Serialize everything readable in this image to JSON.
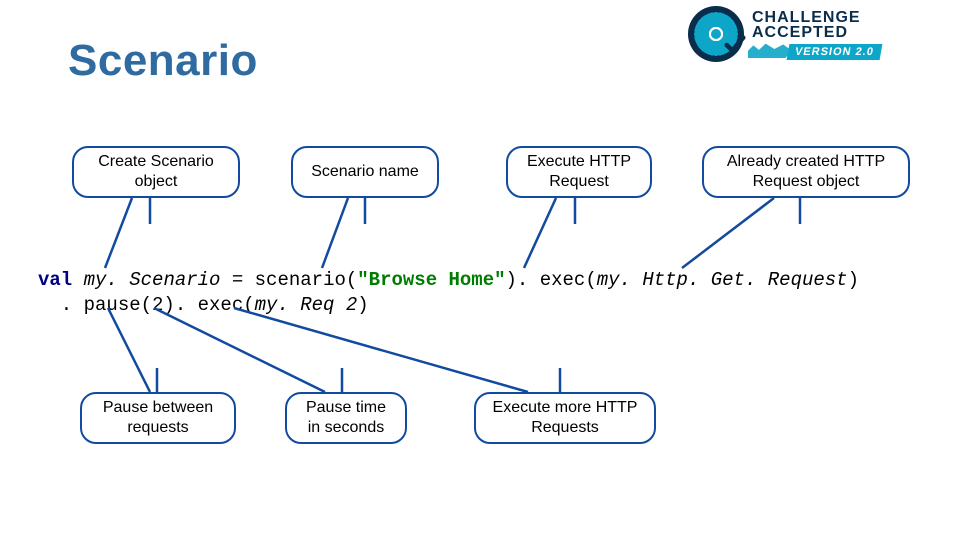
{
  "title": "Scenario",
  "logo": {
    "line1": "CHALLENGE",
    "line2": "ACCEPTED",
    "version": "VERSION 2.0"
  },
  "callouts_top": {
    "create": "Create Scenario\nobject",
    "name": "Scenario name",
    "execute": "Execute HTTP\nRequest",
    "already": "Already created HTTP\nRequest object"
  },
  "callouts_bottom": {
    "pause_between": "Pause between\nrequests",
    "pause_time": "Pause time\nin seconds",
    "execute_more": "Execute more HTTP\nRequests"
  },
  "code": {
    "kw_val": "val",
    "var1": "my. Scenario",
    "eq": " = scenario(",
    "str": "\"Browse Home\"",
    "rest1": "). exec(",
    "var2": "my. Http. Get. Request",
    "rest1b": ")",
    "line2a": "  . pause(2). exec(",
    "var3": "my. Req 2",
    "line2b": ")"
  }
}
